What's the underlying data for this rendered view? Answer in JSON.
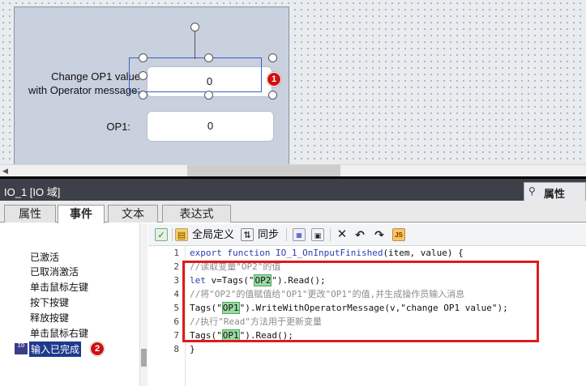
{
  "screen": {
    "change_label_line1": "Change OP1 value",
    "change_label_line2": "with Operator message:",
    "io_field_1_value": "0",
    "op1_label": "OP1:",
    "io_field_2_value": "0",
    "badge_1": "1"
  },
  "inspector": {
    "title": "IO_1  [IO 域]",
    "properties_tab": "属性",
    "tabs": [
      "属性",
      "事件",
      "文本",
      "表达式"
    ]
  },
  "events": {
    "items": [
      "已激活",
      "已取消激活",
      "单击鼠标左键",
      "按下按键",
      "释放按键",
      "单击鼠标右键"
    ],
    "selected": "输入已完成",
    "selected_icon": "IO",
    "badge_2": "2"
  },
  "toolbar": {
    "global_define": "全局定义",
    "sync": "同步"
  },
  "code": {
    "line_numbers": [
      "1",
      "2",
      "3",
      "4",
      "5",
      "6",
      "7",
      "8"
    ],
    "l1_kw1": "export",
    "l1_kw2": "function",
    "l1_name": "IO_1_OnInputFinished",
    "l1_rest": "(item, value) {",
    "l2": "//读取变量\"OP2\"的值",
    "l3_kw": "let",
    "l3_a": " v=Tags(\"",
    "l3_tag": "OP2",
    "l3_b": "\").Read();",
    "l4": "//将\"OP2\"的值赋值给\"OP1\"更改\"OP1\"的值,并生成操作员输入消息",
    "l5_a": "Tags(\"",
    "l5_tag": "OP1",
    "l5_b": "\").WriteWithOperatorMessage(v,\"change OP1 value\");",
    "l6": "//执行\"Read\"方法用于更新变量",
    "l7_a": "Tags(\"",
    "l7_tag": "OP1",
    "l7_b": "\").Read();",
    "l8": "}"
  }
}
